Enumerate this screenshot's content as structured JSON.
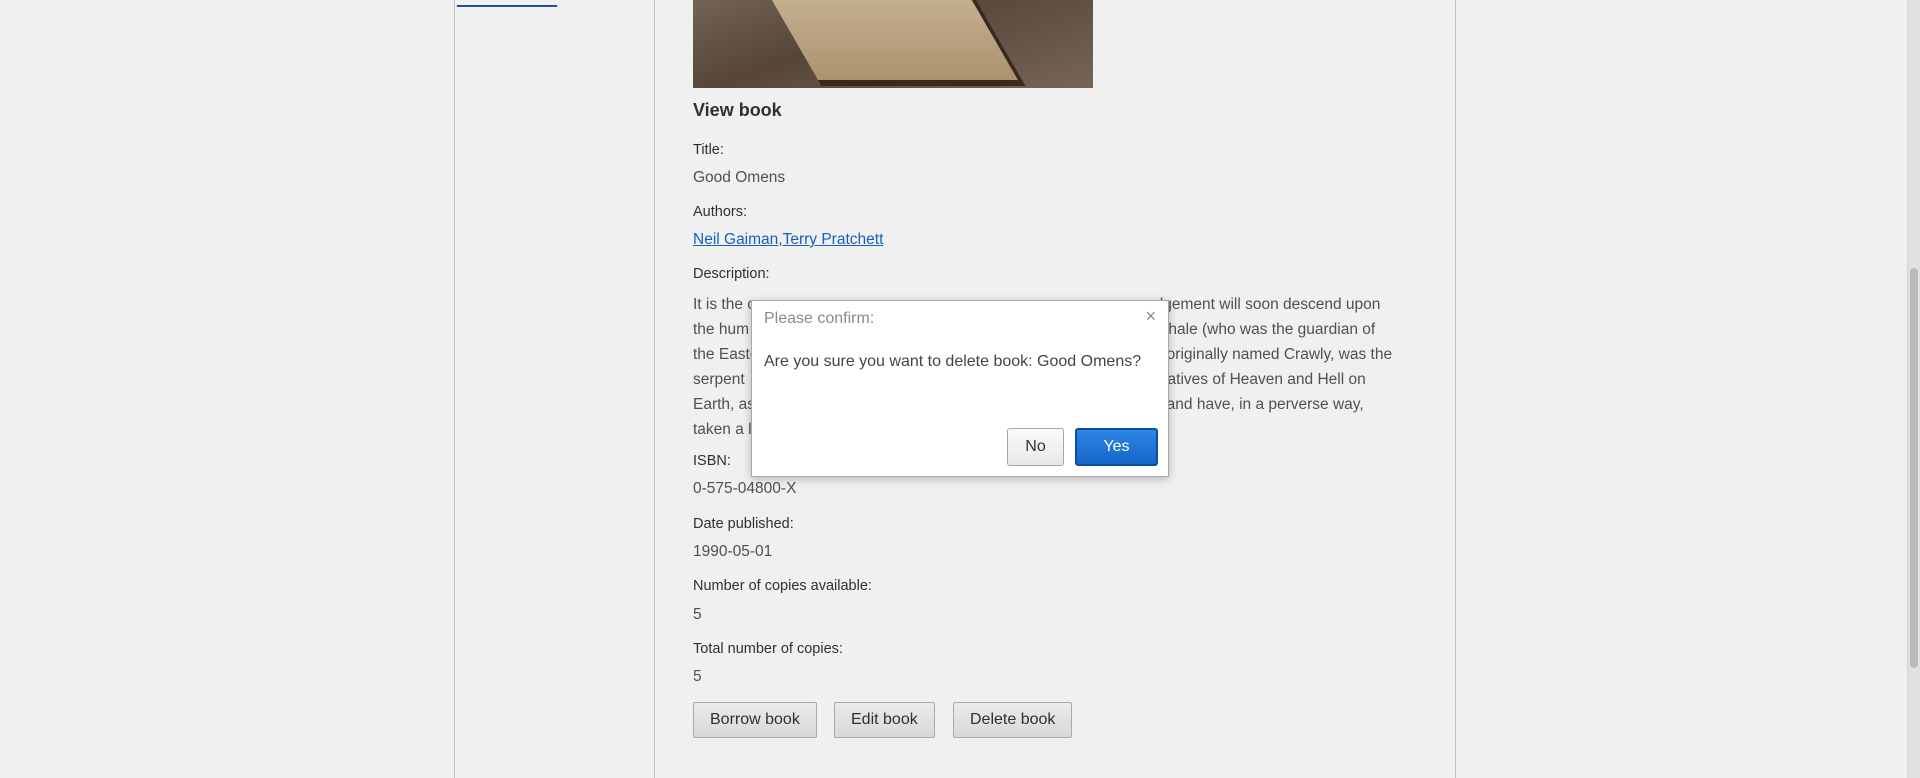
{
  "sidebar": {
    "link_fragment": "____________"
  },
  "book": {
    "section_title": "View book",
    "title_label": "Title:",
    "title": "Good Omens",
    "authors_label": "Authors:",
    "authors": [
      "Neil Gaiman",
      "Terry Pratchett"
    ],
    "authors_separator": ",",
    "description_label": "Description:",
    "description_lines": [
      "It is the c",
      "the hum",
      "the Easte",
      "serpent",
      "Earth, as",
      "taken a l"
    ],
    "description_lines_right": [
      "udgement will soon descend upon",
      "raphale (who was the guardian of",
      "as originally named Crawly, was the",
      "entatives of Heaven and Hell on",
      "es and have, in a perverse way,",
      ""
    ],
    "isbn_label": "ISBN:",
    "isbn": "0-575-04800-X",
    "date_label": "Date published:",
    "date": "1990-05-01",
    "available_label": "Number of copies available:",
    "available": "5",
    "total_label": "Total number of copies:",
    "total": "5"
  },
  "actions": {
    "borrow": "Borrow book",
    "edit": "Edit book",
    "delete": "Delete book"
  },
  "dialog": {
    "title": "Please confirm:",
    "close_glyph": "×",
    "message": "Are you sure you want to delete book: Good Omens?",
    "no_label": "No",
    "yes_label": "Yes"
  }
}
